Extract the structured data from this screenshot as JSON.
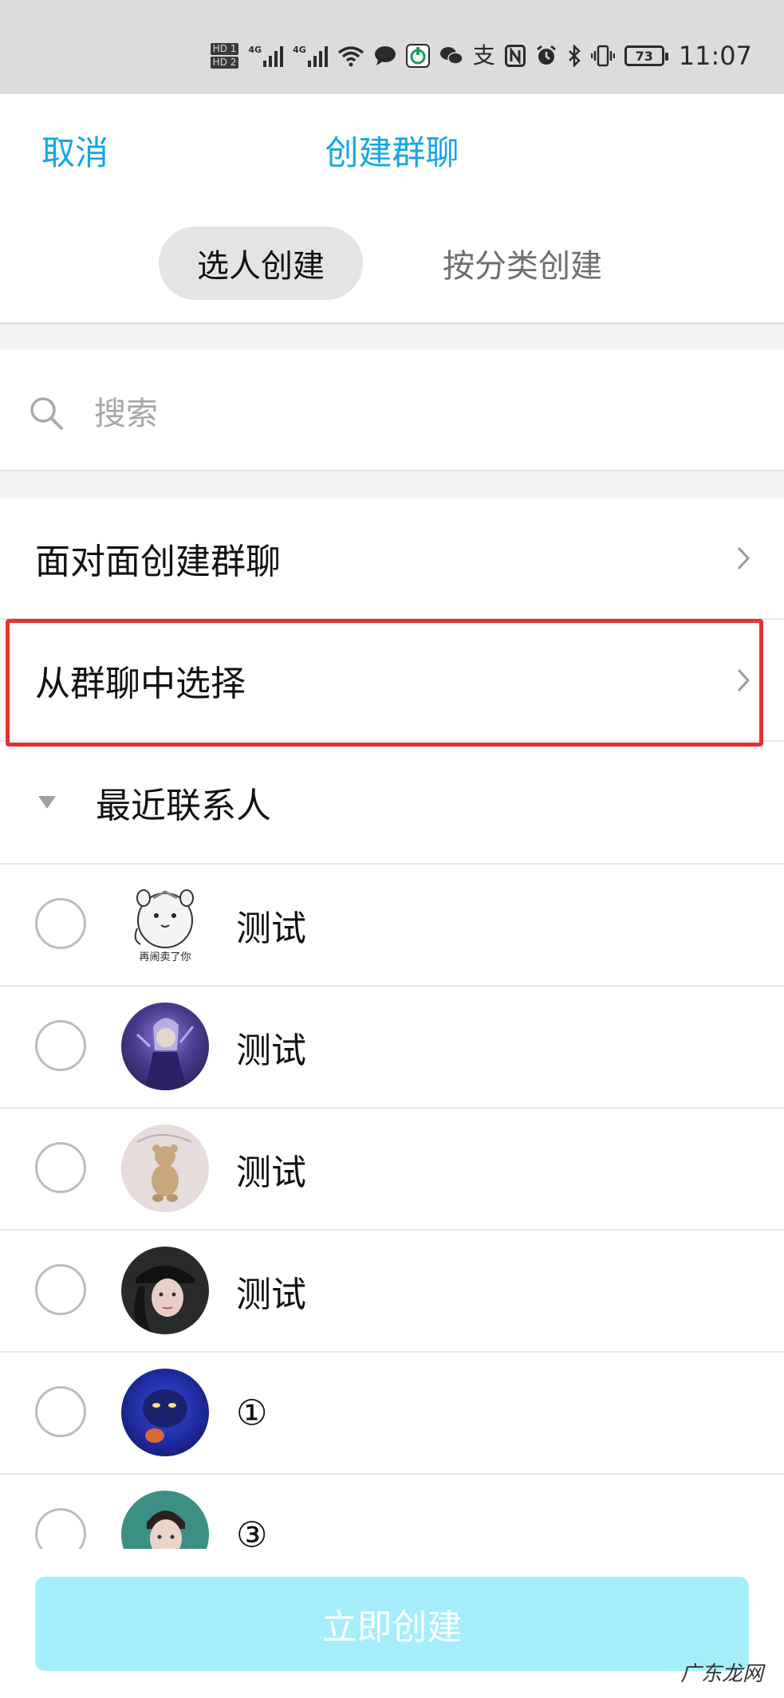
{
  "status_bar": {
    "hd1": "HD 1",
    "hd2": "HD 2",
    "net1": "4G",
    "net2": "4G",
    "battery": "73",
    "time": "11:07",
    "icons": [
      "wifi-icon",
      "message-icon",
      "charging-app-icon",
      "wechat-icon",
      "alipay-icon",
      "nfc-icon",
      "alarm-icon",
      "bluetooth-icon",
      "vibrate-icon",
      "battery-icon"
    ]
  },
  "header": {
    "cancel_label": "取消",
    "title": "创建群聊"
  },
  "tabs": [
    {
      "label": "选人创建",
      "active": true
    },
    {
      "label": "按分类创建",
      "active": false
    }
  ],
  "search": {
    "placeholder": "搜索"
  },
  "options": [
    {
      "label": "面对面创建群聊"
    },
    {
      "label": "从群聊中选择",
      "highlighted": true
    }
  ],
  "section": {
    "label": "最近联系人"
  },
  "contacts": [
    {
      "name": "测试",
      "avatar": "hamster-sticker",
      "avatar_caption": "再闹卖了你"
    },
    {
      "name": "测试",
      "avatar": "game-character"
    },
    {
      "name": "测试",
      "avatar": "teddy-bear"
    },
    {
      "name": "测试",
      "avatar": "person-cap"
    },
    {
      "name": "①",
      "avatar": "blue-creature"
    },
    {
      "name": "③",
      "avatar": "boy-portrait"
    }
  ],
  "footer": {
    "create_label": "立即创建"
  },
  "watermark": "广东龙网",
  "colors": {
    "accent": "#12a7e6",
    "highlight_border": "#e23333",
    "create_button_bg": "#a4eefb",
    "status_bar_bg": "#dcdcdc"
  }
}
